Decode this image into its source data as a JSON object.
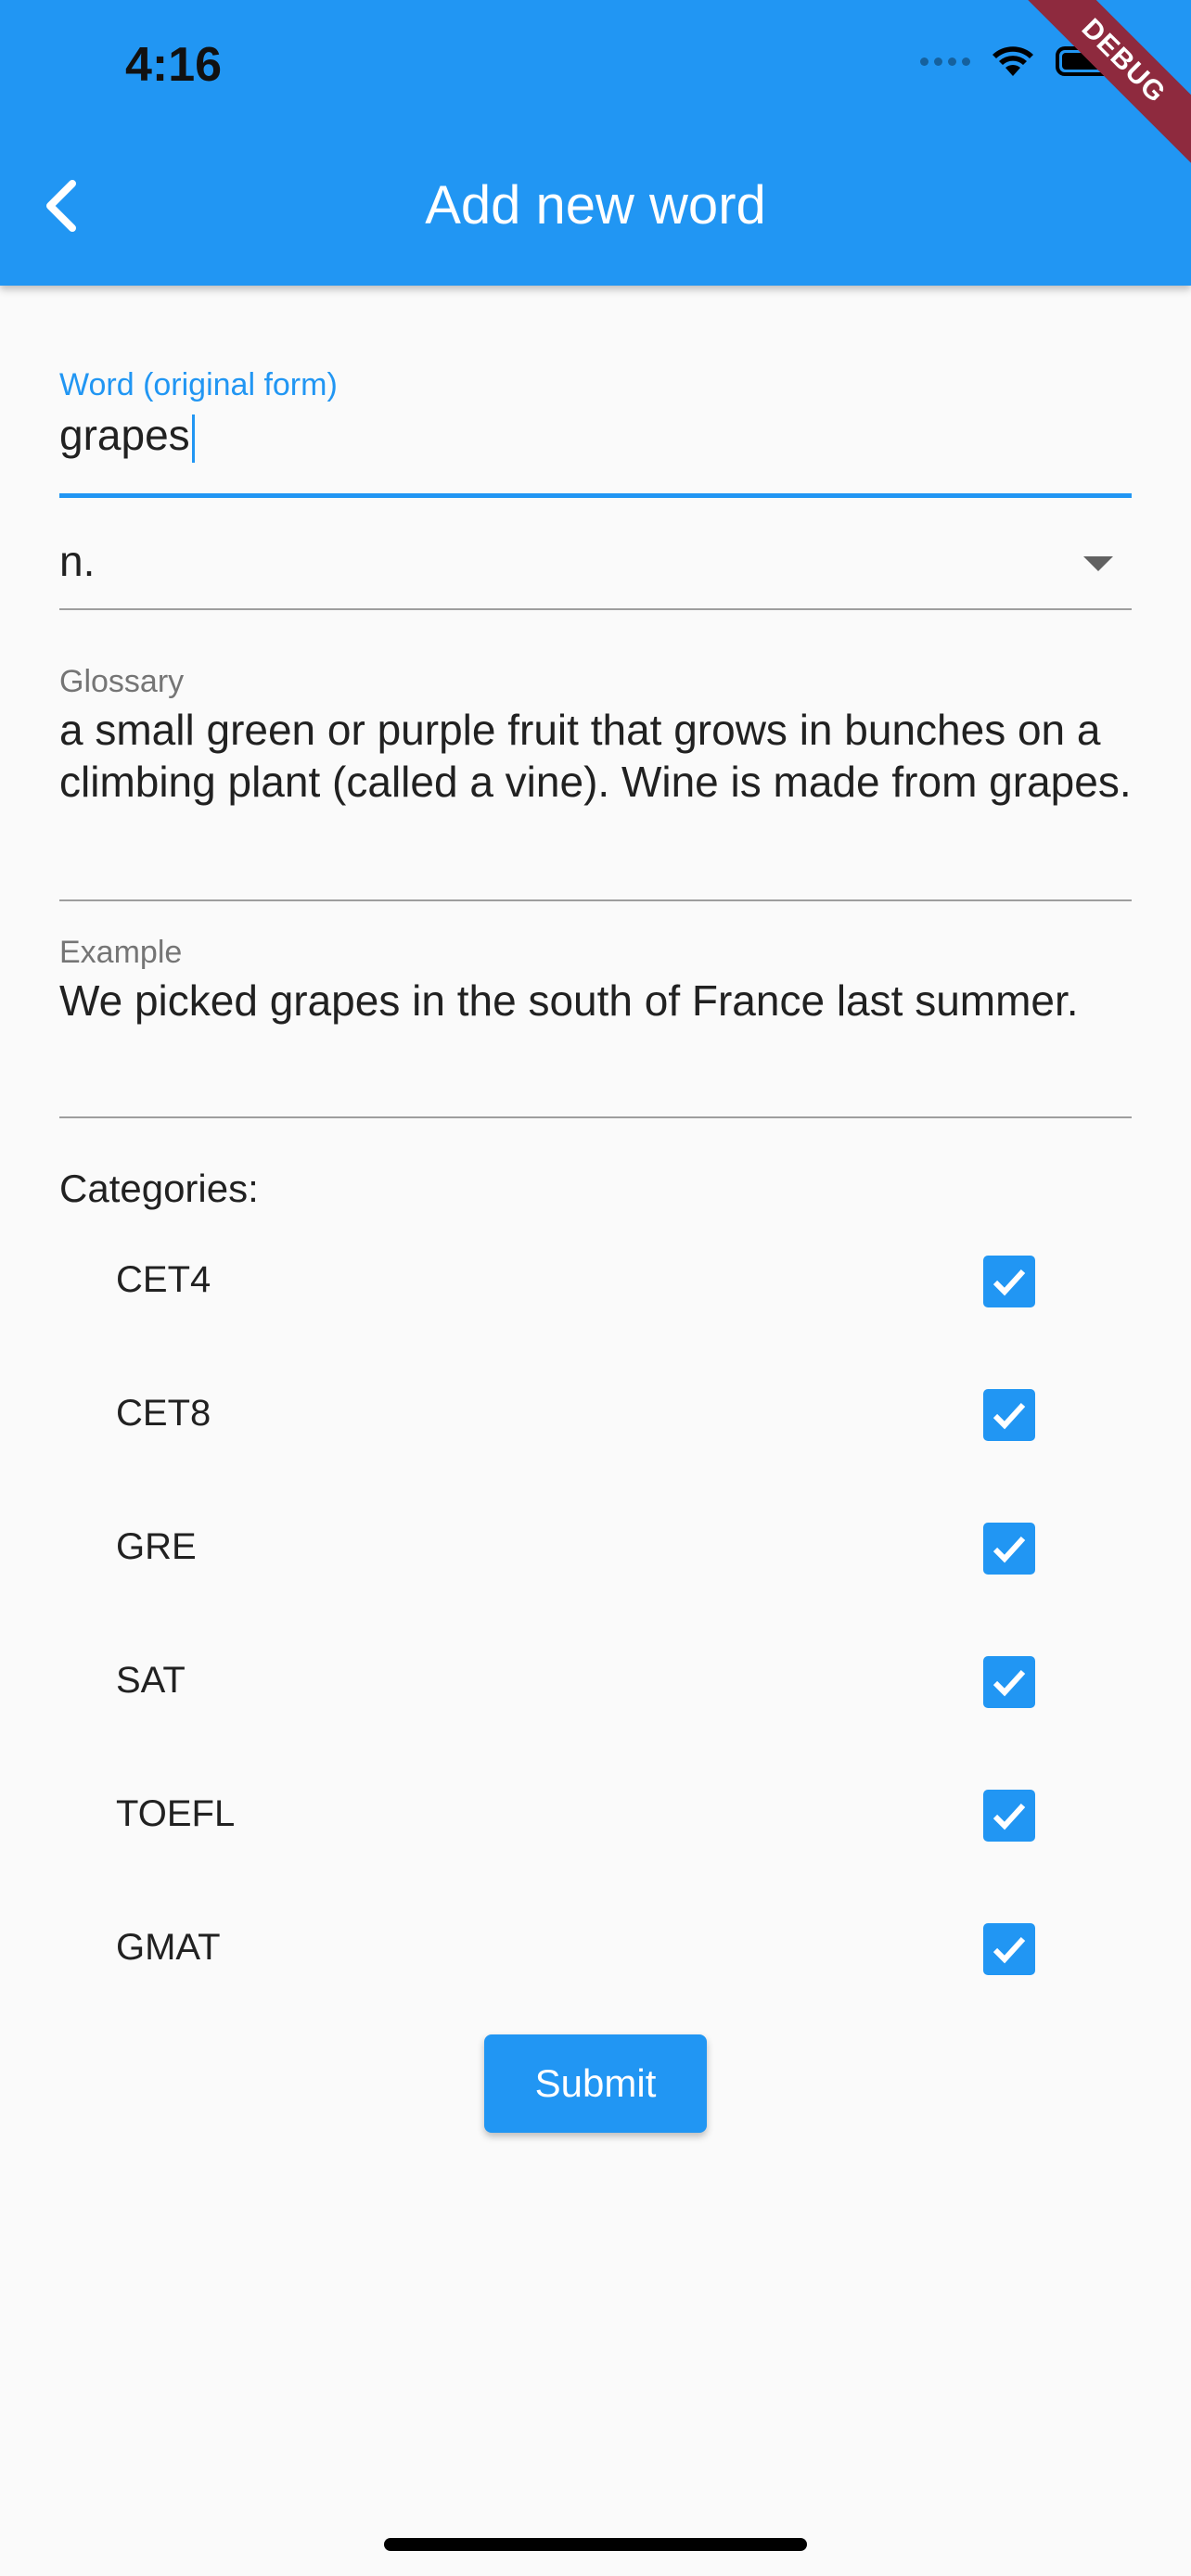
{
  "status_bar": {
    "time": "4:16"
  },
  "debug_banner": "DEBUG",
  "app_bar": {
    "title": "Add new word",
    "back_icon": "chevron-left-icon"
  },
  "form": {
    "word": {
      "label": "Word (original form)",
      "value": "grapes"
    },
    "part_of_speech": {
      "value": "n."
    },
    "glossary": {
      "label": "Glossary",
      "value": "a small green or purple fruit that grows in bunches on a climbing plant (called a vine). Wine is made from grapes."
    },
    "example": {
      "label": "Example",
      "value": "We picked grapes in the south of France last summer."
    },
    "categories_title": "Categories:",
    "categories": [
      {
        "label": "CET4",
        "checked": true
      },
      {
        "label": "CET8",
        "checked": true
      },
      {
        "label": "GRE",
        "checked": true
      },
      {
        "label": "SAT",
        "checked": true
      },
      {
        "label": "TOEFL",
        "checked": true
      },
      {
        "label": "GMAT",
        "checked": true
      }
    ],
    "submit_label": "Submit"
  },
  "colors": {
    "primary": "#2196f3",
    "debug": "#8e2a3e"
  }
}
